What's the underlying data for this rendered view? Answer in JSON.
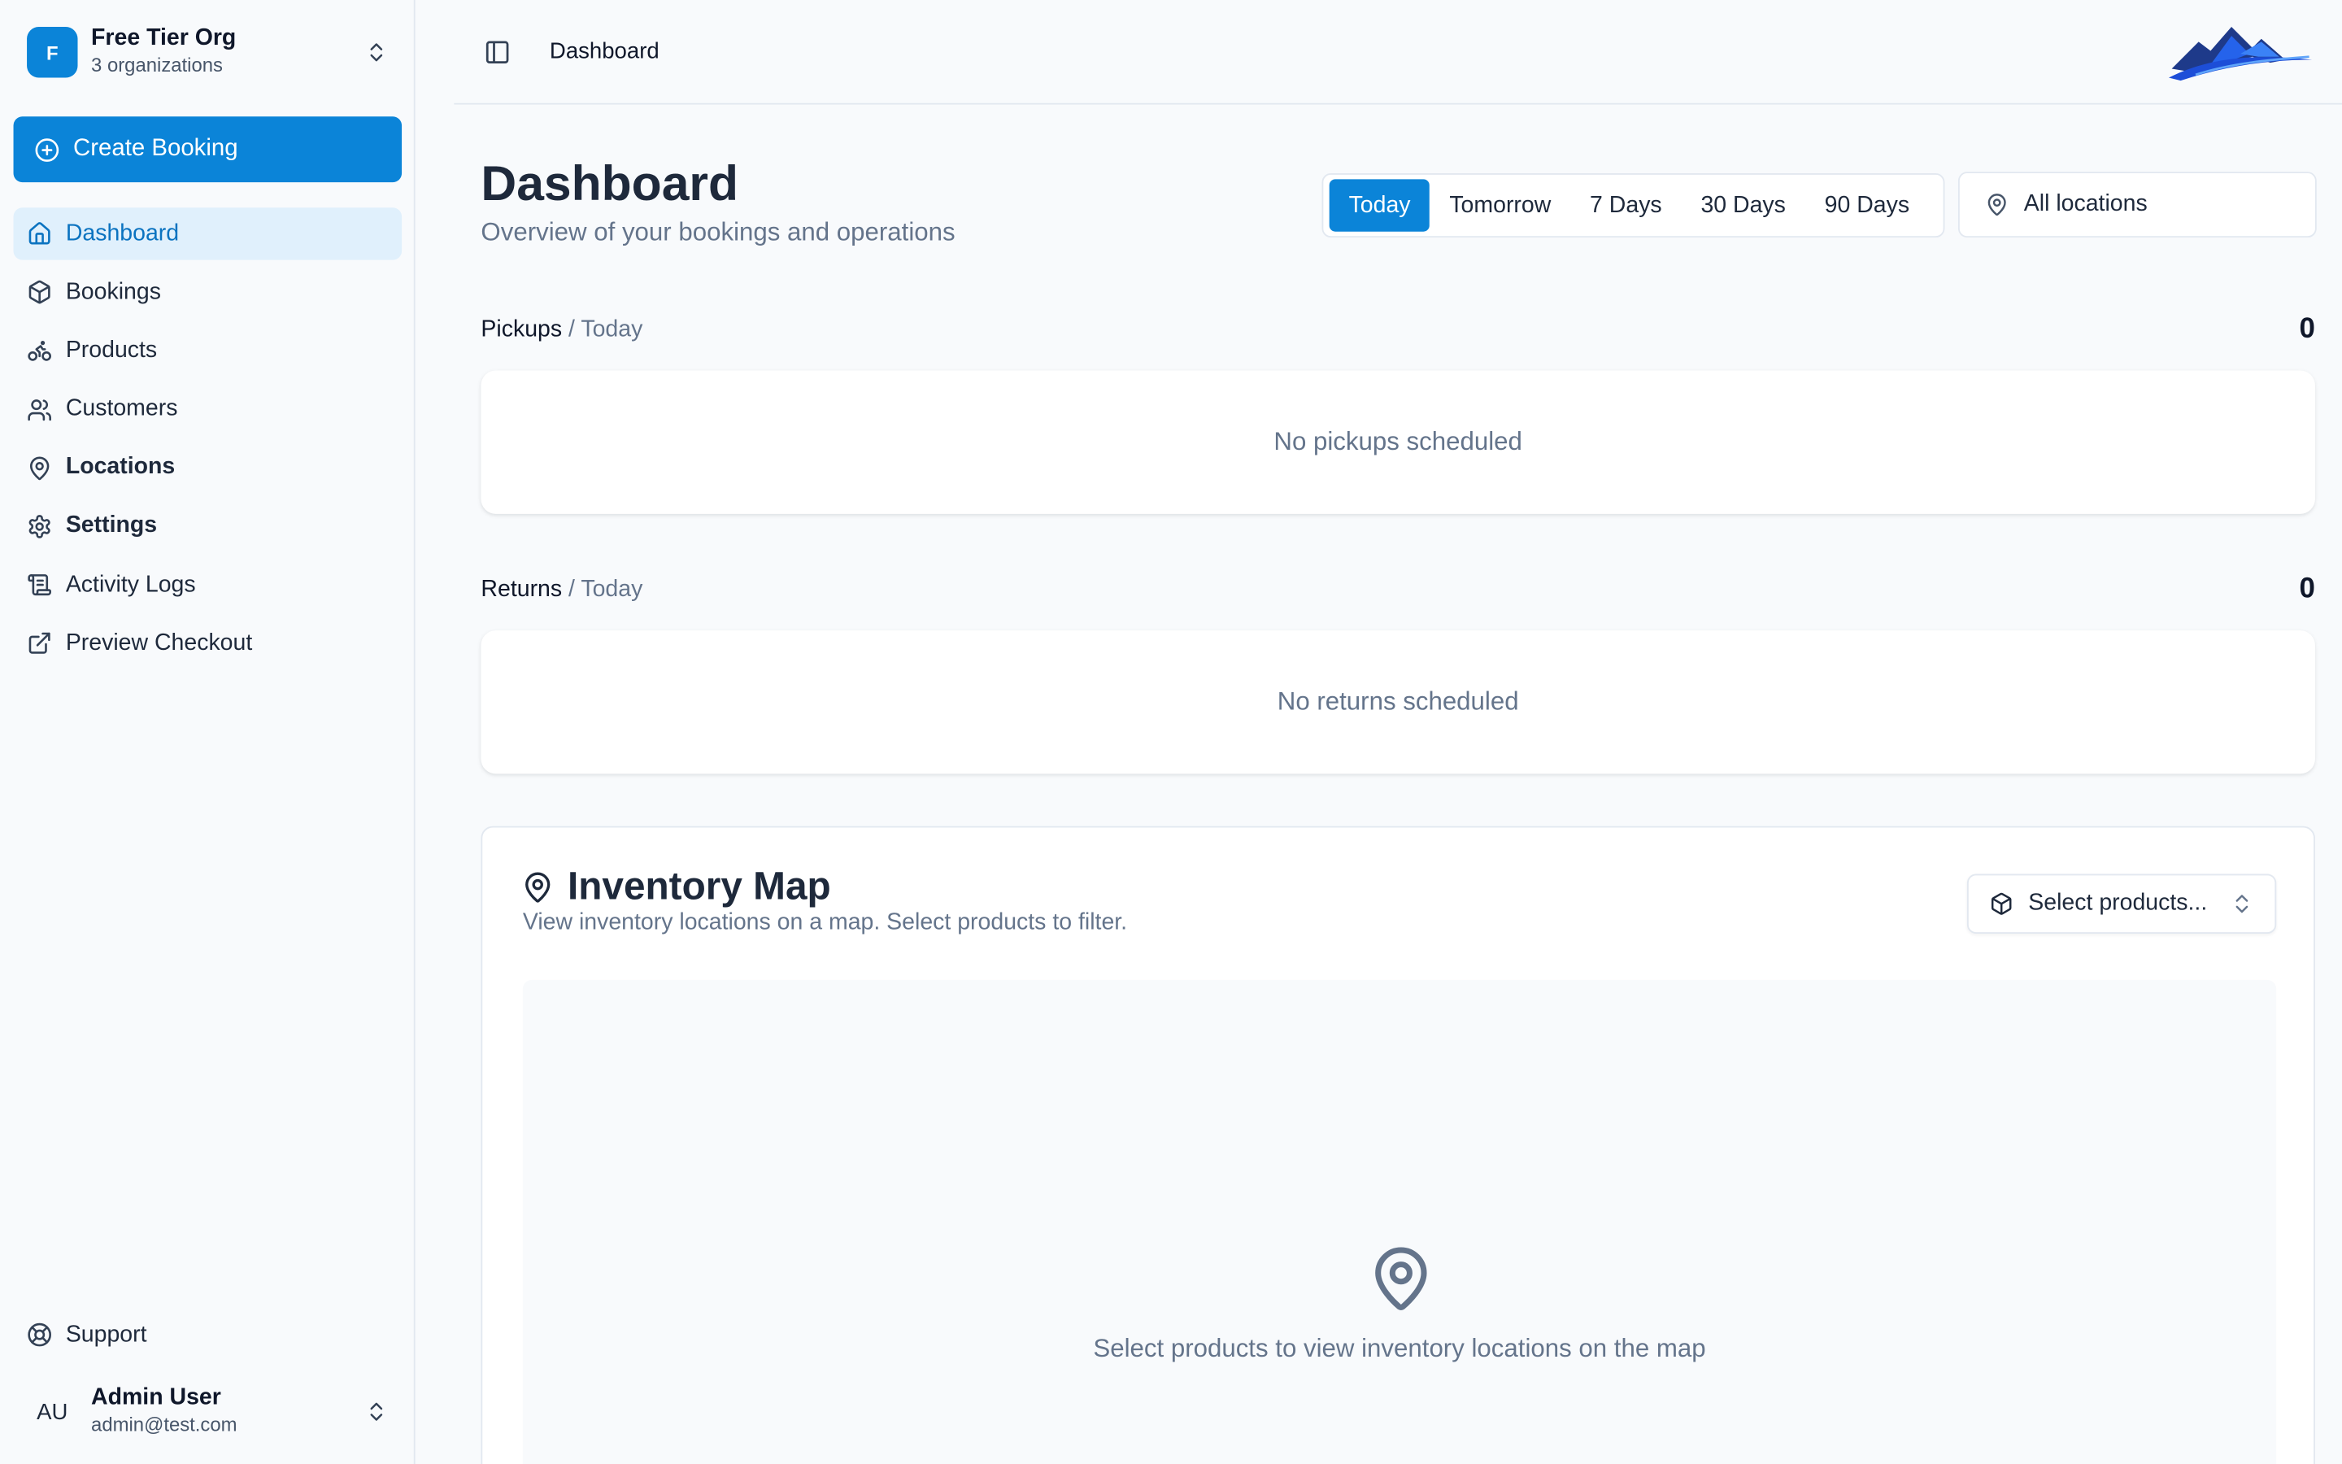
{
  "org": {
    "initial": "F",
    "name": "Free Tier Org",
    "subtitle": "3 organizations"
  },
  "create_booking_label": "Create Booking",
  "nav": [
    {
      "label": "Dashboard",
      "icon": "home-icon"
    },
    {
      "label": "Bookings",
      "icon": "box-icon"
    },
    {
      "label": "Products",
      "icon": "bike-icon"
    },
    {
      "label": "Customers",
      "icon": "users-icon"
    },
    {
      "label": "Locations",
      "icon": "map-pin-icon"
    },
    {
      "label": "Settings",
      "icon": "gear-icon"
    },
    {
      "label": "Activity Logs",
      "icon": "scroll-icon"
    },
    {
      "label": "Preview Checkout",
      "icon": "external-link-icon"
    }
  ],
  "support_label": "Support",
  "user": {
    "initials": "AU",
    "name": "Admin User",
    "email": "admin@test.com"
  },
  "topbar": {
    "breadcrumb": "Dashboard"
  },
  "page": {
    "title": "Dashboard",
    "subtitle": "Overview of your bookings and operations"
  },
  "ranges": [
    "Today",
    "Tomorrow",
    "7 Days",
    "30 Days",
    "90 Days"
  ],
  "active_range": "Today",
  "location_select": "All locations",
  "pickups": {
    "label": "Pickups",
    "sep": " / ",
    "period": "Today",
    "count": "0",
    "empty": "No pickups scheduled"
  },
  "returns": {
    "label": "Returns",
    "sep": " / ",
    "period": "Today",
    "count": "0",
    "empty": "No returns scheduled"
  },
  "inventory_map": {
    "title": "Inventory Map",
    "description": "View inventory locations on a map. Select products to filter.",
    "select_placeholder": "Select products...",
    "empty": "Select products to view inventory locations on the map"
  },
  "colors": {
    "accent": "#0b84d8",
    "active_nav_bg": "#e0f0fc",
    "background": "#f8fafc",
    "muted_text": "#64748b"
  }
}
